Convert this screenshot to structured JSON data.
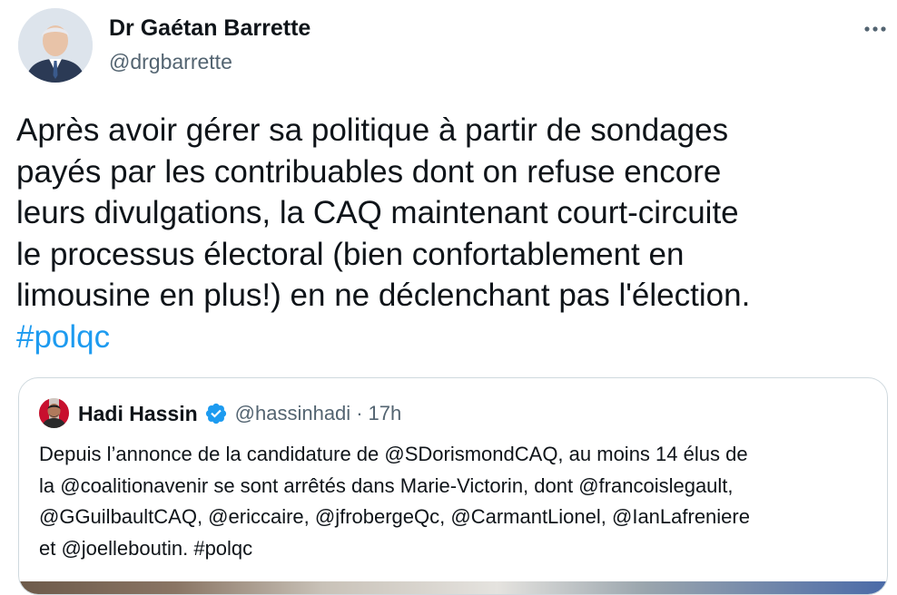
{
  "tweet": {
    "author": {
      "name": "Dr Gaétan Barrette",
      "handle": "@drgbarrette"
    },
    "more_icon": "more-horizontal-icon",
    "text_lines": [
      "Après avoir gérer sa politique à partir de sondages",
      "payés par les contribuables dont on refuse encore",
      "leurs divulgations, la CAQ maintenant court-circuite",
      "le processus électoral (bien confortablement en",
      "limousine en plus!) en ne déclenchant pas l'élection."
    ],
    "hashtag": "#polqc"
  },
  "quote": {
    "author": {
      "name": "Hadi Hassin",
      "handle": "@hassinhadi",
      "separator": "·",
      "time": "17h",
      "verified_icon": "verified-badge-icon"
    },
    "text_lines": [
      "Depuis l’annonce de la candidature de @SDorismondCAQ, au moins 14 élus de",
      "la @coalitionavenir se sont arrêtés dans Marie-Victorin, dont @francoislegault,",
      "@GGuilbaultCAQ, @ericcaire, @jfrobergeQc, @CarmantLionel, @IanLafreniere",
      "et @joelleboutin. #polqc"
    ]
  },
  "colors": {
    "text": "#0f1419",
    "secondary": "#536471",
    "link": "#1d9bf0",
    "border": "#cfd9de",
    "verified": "#1d9bf0"
  }
}
